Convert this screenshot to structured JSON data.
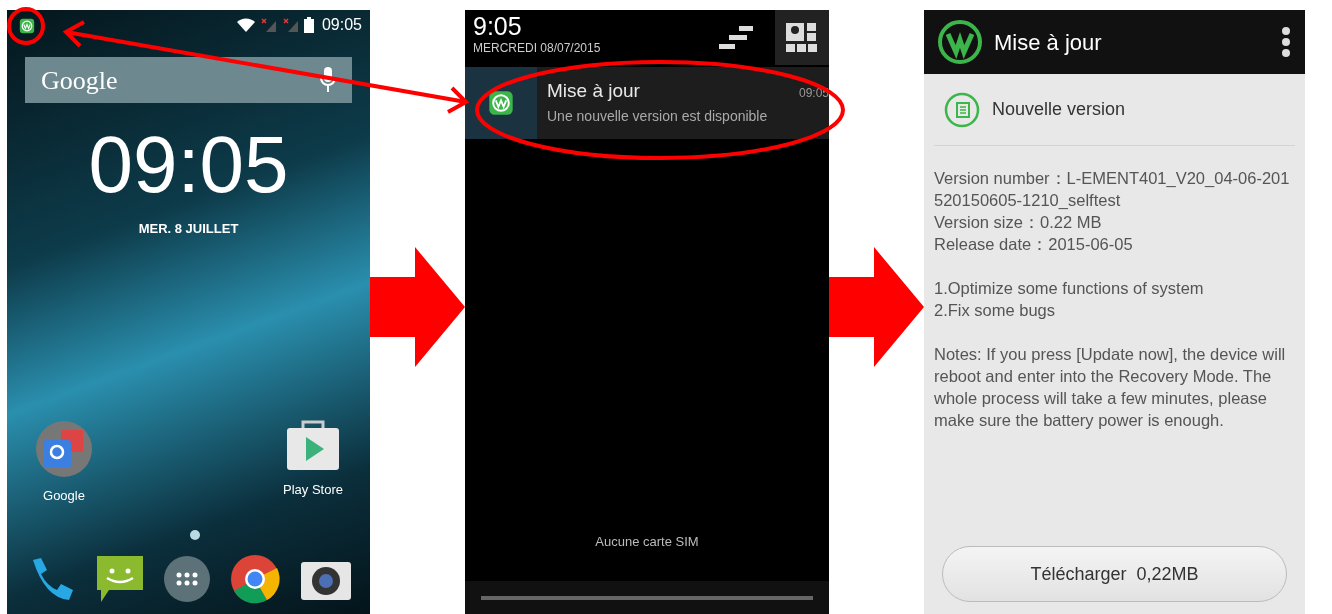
{
  "home_screen": {
    "status_bar": {
      "time": "09:05"
    },
    "search_bar": {
      "label": "Google"
    },
    "clock": {
      "time": "09:05",
      "date": "MER. 8 JUILLET"
    },
    "apps": [
      {
        "label": "Google"
      },
      {
        "label": "Play Store"
      }
    ]
  },
  "notification_shade": {
    "time": "9:05",
    "date": "MERCREDI 08/07/2015",
    "notifications": [
      {
        "title": "Mise à jour",
        "time": "09:05",
        "text": "Une nouvelle version est disponible"
      }
    ],
    "footer": "Aucune carte SIM"
  },
  "update_screen": {
    "title": "Mise à jour",
    "section": "Nouvelle version",
    "details": [
      "Version number：L-EMENT401_V20_04-06-201520150605-1210_selftest",
      "Version size：0.22 MB",
      "Release date：2015-06-05"
    ],
    "changes": [
      "1.Optimize some functions of system",
      "2.Fix some bugs"
    ],
    "notes": "Notes: If you press [Update now], the device will reboot and enter into the Recovery Mode. The whole process will take a few minutes, please make sure the battery power is enough.",
    "button": "Télécharger  0,22MB"
  }
}
